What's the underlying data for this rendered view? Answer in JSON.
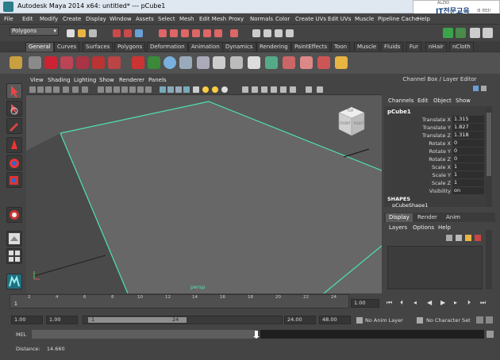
{
  "window": {
    "title": "Autodesk Maya 2014 x64: untitled*   ---   pCube1"
  },
  "logo": {
    "line1": "ALZIO",
    "line2": "IT전문교육",
    "line3": "의 리더!"
  },
  "menubar": [
    "File",
    "Edit",
    "Modify",
    "Create",
    "Display",
    "Window",
    "Assets",
    "Select",
    "Mesh",
    "Edit Mesh",
    "Proxy",
    "Normals",
    "Color",
    "Create UVs",
    "Edit UVs",
    "Muscle",
    "Pipeline Cache",
    "Help"
  ],
  "mode_selector": "Polygons",
  "shelf_tabs": [
    "General",
    "Curves",
    "Surfaces",
    "Polygons",
    "Deformation",
    "Animation",
    "Dynamics",
    "Rendering",
    "PaintEffects",
    "Toon",
    "Muscle",
    "Fluids",
    "Fur",
    "nHair",
    "nCloth"
  ],
  "viewport": {
    "menu": [
      "View",
      "Shading",
      "Lighting",
      "Show",
      "Renderer",
      "Panels"
    ],
    "camera_label": "persp",
    "viewcube": {
      "top": "TOP",
      "front": "FRONT",
      "right": "RIGHT"
    }
  },
  "channel_box": {
    "header": "Channel Box / Layer Editor",
    "menu": [
      "Channels",
      "Edit",
      "Object",
      "Show"
    ],
    "object_name": "pCube1",
    "attributes": [
      {
        "name": "Translate X",
        "value": "1.315"
      },
      {
        "name": "Translate Y",
        "value": "1.827"
      },
      {
        "name": "Translate Z",
        "value": "1.318"
      },
      {
        "name": "Rotate X",
        "value": "0"
      },
      {
        "name": "Rotate Y",
        "value": "0"
      },
      {
        "name": "Rotate Z",
        "value": "0"
      },
      {
        "name": "Scale X",
        "value": "1"
      },
      {
        "name": "Scale Y",
        "value": "1"
      },
      {
        "name": "Scale Z",
        "value": "1"
      },
      {
        "name": "Visibility",
        "value": "on"
      }
    ],
    "shapes_label": "SHAPES",
    "shape_name": "pCubeShape1"
  },
  "layer_editor": {
    "tabs": [
      "Display",
      "Render",
      "Anim"
    ],
    "menu": [
      "Layers",
      "Options",
      "Help"
    ]
  },
  "timeline": {
    "ticks": [
      "2",
      "4",
      "6",
      "8",
      "10",
      "12",
      "14",
      "16",
      "18",
      "20",
      "22",
      "24"
    ],
    "current_frame": "1",
    "current_time_field": "1.00"
  },
  "range": {
    "start": "1.00",
    "playback_start": "1.00",
    "slider_start": "1",
    "slider_end": "24",
    "playback_end": "24.00",
    "end": "48.00",
    "anim_layer": "No Anim Layer",
    "character_set": "No Character Set"
  },
  "command_line": {
    "label": "MEL"
  },
  "help_line": {
    "text": "Distance:    14.660"
  }
}
